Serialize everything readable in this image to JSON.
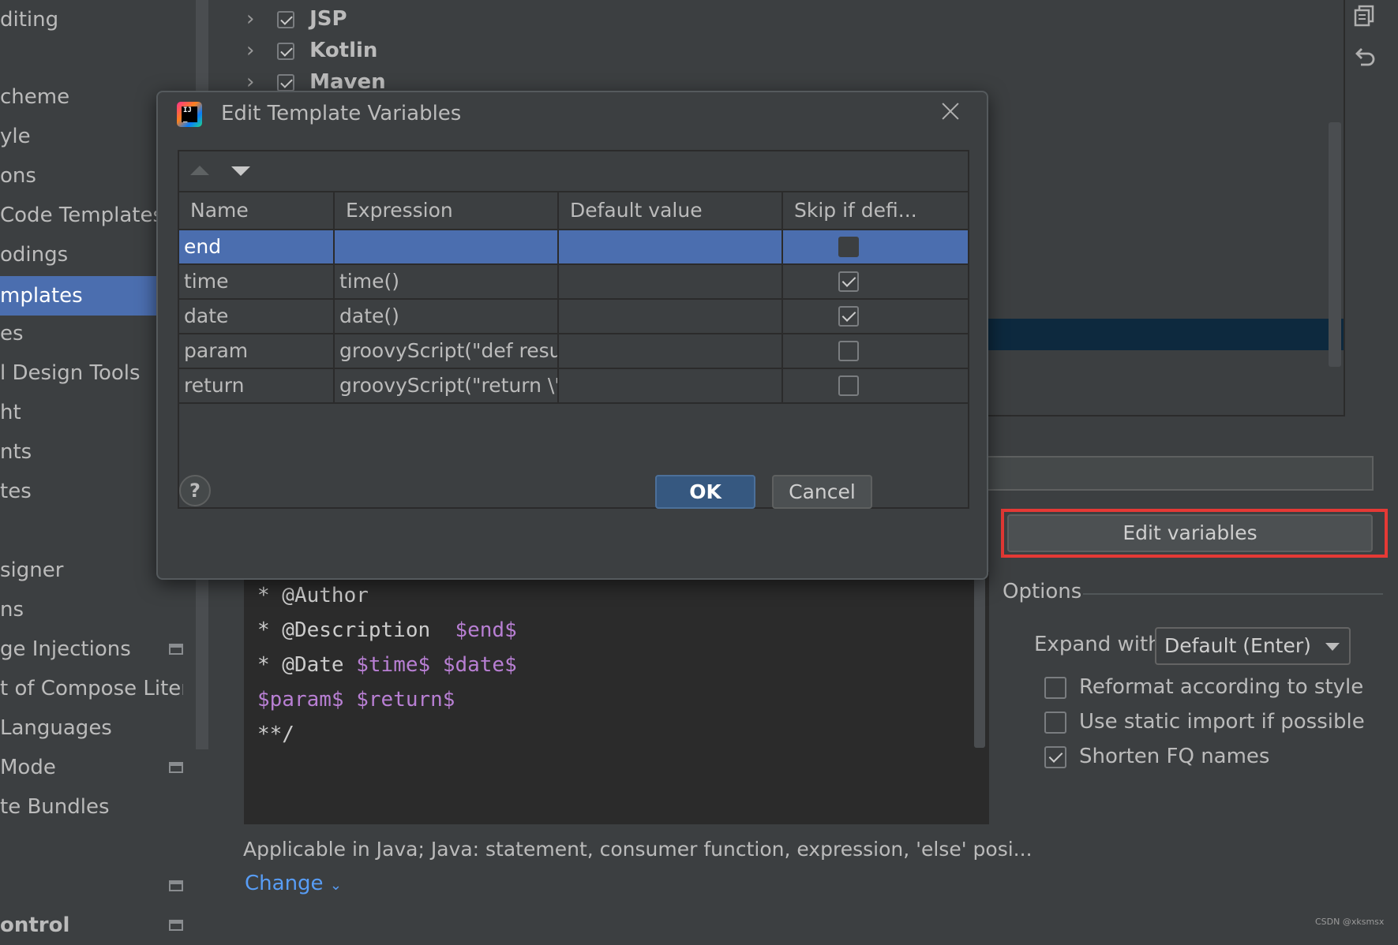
{
  "sidebar": {
    "items": [
      {
        "label": "diting"
      },
      {
        "label": "cheme"
      },
      {
        "label": "yle"
      },
      {
        "label": "ons"
      },
      {
        "label": " Code Templates"
      },
      {
        "label": "odings"
      },
      {
        "label": "mplates"
      },
      {
        "label": "es"
      },
      {
        "label": "l Design Tools"
      },
      {
        "label": "ht"
      },
      {
        "label": "nts"
      },
      {
        "label": "tes"
      },
      {
        "label": "signer"
      },
      {
        "label": "ns"
      },
      {
        "label": "ge Injections"
      },
      {
        "label": "t of Compose Literal:"
      },
      {
        "label": " Languages"
      },
      {
        "label": "Mode"
      },
      {
        "label": "te Bundles"
      },
      {
        "label": "ontrol"
      }
    ],
    "selected": "mplates"
  },
  "tree": {
    "rows": [
      {
        "label": "JSP",
        "checked": true
      },
      {
        "label": "Kotlin",
        "checked": true
      },
      {
        "label": "Maven",
        "checked": true
      }
    ]
  },
  "dialog": {
    "title": "Edit Template Variables",
    "columns": [
      "Name",
      "Expression",
      "Default value",
      "Skip if defi..."
    ],
    "rows": [
      {
        "name": "end",
        "expression": "",
        "default": "",
        "skip": false,
        "selected": true
      },
      {
        "name": "time",
        "expression": "time()",
        "default": "",
        "skip": true
      },
      {
        "name": "date",
        "expression": "date()",
        "default": "",
        "skip": true
      },
      {
        "name": "param",
        "expression": "groovyScript(\"def result...",
        "default": "",
        "skip": false
      },
      {
        "name": "return",
        "expression": "groovyScript(\"return \\\"...",
        "default": "",
        "skip": false
      }
    ],
    "help_label": "?",
    "ok_label": "OK",
    "cancel_label": "Cancel"
  },
  "editor": {
    "line1": "* @Author",
    "line2_prefix": "* @Description  ",
    "line2_var": "$end$",
    "line3_prefix": "* @Date ",
    "line3_var1": "$time$",
    "line3_var2": "$date$",
    "line4_var1": "$param$",
    "line4_var2": "$return$",
    "line5": "**/"
  },
  "edit_variables_label": "Edit variables",
  "options": {
    "title": "Options",
    "expand_label": "Expand with",
    "expand_value": "Default (Enter)",
    "checks": [
      {
        "label": "Reformat according to style",
        "checked": false
      },
      {
        "label": "Use static import if possible",
        "checked": false
      },
      {
        "label": "Shorten FQ names",
        "checked": true
      }
    ]
  },
  "applicable_text": "Applicable in Java; Java: statement, consumer function, expression, 'else' posi...",
  "change_label": "Change",
  "watermark": "CSDN @xksmsx",
  "colors": {
    "accent_selection": "#4b6eaf",
    "ok_button": "#365880",
    "highlight_frame": "#e53935",
    "template_variable": "#b87fd3",
    "link": "#589df6"
  }
}
